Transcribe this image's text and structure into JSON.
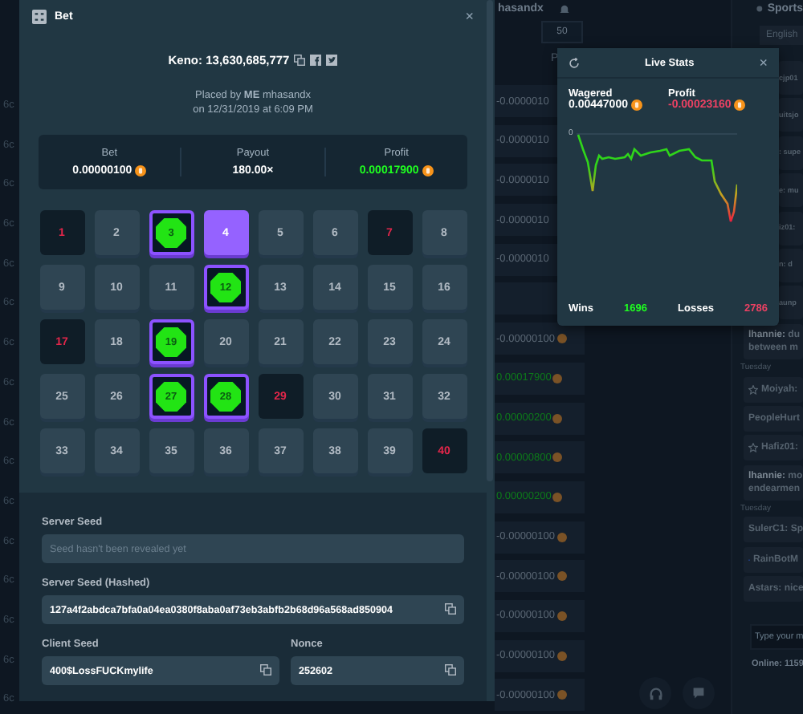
{
  "background": {
    "left_rows": [
      "6c",
      "6c",
      "6c",
      "6c",
      "6c",
      "6c",
      "6c",
      "6c",
      "6c",
      "6c",
      "6c",
      "6c",
      "6c",
      "6c",
      "6c",
      "6c"
    ],
    "user_menu": "hasandx",
    "page_size": "50",
    "column_header": "P",
    "profits": [
      {
        "value": "-0.0000010",
        "positive": false,
        "coin": false
      },
      {
        "value": "-0.0000010",
        "positive": false,
        "coin": false
      },
      {
        "value": "-0.0000010",
        "positive": false,
        "coin": false
      },
      {
        "value": "-0.0000010",
        "positive": false,
        "coin": false
      },
      {
        "value": "-0.0000010",
        "positive": false,
        "coin": false
      },
      {
        "value": "-0.00000100",
        "positive": false,
        "coin": true
      },
      {
        "value": "0.00017900",
        "positive": true,
        "coin": true
      },
      {
        "value": "0.00000200",
        "positive": true,
        "coin": true
      },
      {
        "value": "0.00000800",
        "positive": true,
        "coin": true
      },
      {
        "value": "0.00000200",
        "positive": true,
        "coin": true
      },
      {
        "value": "-0.00000100",
        "positive": false,
        "coin": true
      },
      {
        "value": "-0.00000100",
        "positive": false,
        "coin": true
      },
      {
        "value": "-0.00000100",
        "positive": false,
        "coin": true
      },
      {
        "value": "-0.00000100",
        "positive": false,
        "coin": true
      },
      {
        "value": "-0.00000100",
        "positive": false,
        "coin": true
      }
    ]
  },
  "chat": {
    "sports": "Sports",
    "language": "English",
    "messages": [
      {
        "kind": "cut",
        "lines": [
          "cjp01"
        ]
      },
      {
        "kind": "cut",
        "lines": [
          "uitsjo"
        ]
      },
      {
        "kind": "cut",
        "lines": [
          ": supe"
        ]
      },
      {
        "kind": "cut",
        "lines": [
          "e: mu"
        ]
      },
      {
        "kind": "cut",
        "lines": [
          "iz01:"
        ]
      },
      {
        "kind": "cut",
        "lines": [
          "n: d"
        ]
      },
      {
        "kind": "cut",
        "lines": [
          "aunp"
        ]
      },
      {
        "kind": "message",
        "lines": [
          "**lhannie:** du",
          "between m"
        ]
      },
      {
        "kind": "day",
        "lines": [
          "Tuesday"
        ]
      },
      {
        "kind": "starred",
        "lines": [
          "Moiyah:"
        ]
      },
      {
        "kind": "message",
        "lines": [
          "PeopleHurt"
        ]
      },
      {
        "kind": "starred",
        "lines": [
          "Hafiz01:"
        ]
      },
      {
        "kind": "message",
        "lines": [
          "**lhannie:** mo",
          "endearmen"
        ]
      },
      {
        "kind": "day",
        "lines": [
          "Tuesday"
        ]
      },
      {
        "kind": "message",
        "lines": [
          "SulerC1: Sp"
        ]
      },
      {
        "kind": "bot",
        "lines": [
          "RainBotM"
        ]
      },
      {
        "kind": "message",
        "lines": [
          "Astars: nice"
        ]
      }
    ],
    "input_placeholder": "Type your m",
    "online": "Online: 1159"
  },
  "modal": {
    "title": "Bet",
    "close": "×",
    "game_id": "Keno: 13,630,685,777",
    "placed_by": "Placed by **ME** mhasandx",
    "placed_on": "on 12/31/2019 at 6:09 PM",
    "stats": [
      {
        "label": "Bet",
        "value": "0.00000100",
        "coin": true,
        "positive": false
      },
      {
        "label": "Payout",
        "value": "180.00×",
        "coin": false,
        "positive": false
      },
      {
        "label": "Profit",
        "value": "0.00017900",
        "coin": true,
        "positive": true
      }
    ],
    "tiles": [
      {
        "number": "1",
        "selected": false,
        "drawn": true
      },
      {
        "number": "2",
        "selected": false,
        "drawn": false
      },
      {
        "number": "3",
        "selected": true,
        "drawn": true
      },
      {
        "number": "4",
        "selected": true,
        "drawn": false
      },
      {
        "number": "5",
        "selected": false,
        "drawn": false
      },
      {
        "number": "6",
        "selected": false,
        "drawn": false
      },
      {
        "number": "7",
        "selected": false,
        "drawn": true
      },
      {
        "number": "8",
        "selected": false,
        "drawn": false
      },
      {
        "number": "9",
        "selected": false,
        "drawn": false
      },
      {
        "number": "10",
        "selected": false,
        "drawn": false
      },
      {
        "number": "11",
        "selected": false,
        "drawn": false
      },
      {
        "number": "12",
        "selected": true,
        "drawn": true
      },
      {
        "number": "13",
        "selected": false,
        "drawn": false
      },
      {
        "number": "14",
        "selected": false,
        "drawn": false
      },
      {
        "number": "15",
        "selected": false,
        "drawn": false
      },
      {
        "number": "16",
        "selected": false,
        "drawn": false
      },
      {
        "number": "17",
        "selected": false,
        "drawn": true
      },
      {
        "number": "18",
        "selected": false,
        "drawn": false
      },
      {
        "number": "19",
        "selected": true,
        "drawn": true
      },
      {
        "number": "20",
        "selected": false,
        "drawn": false
      },
      {
        "number": "21",
        "selected": false,
        "drawn": false
      },
      {
        "number": "22",
        "selected": false,
        "drawn": false
      },
      {
        "number": "23",
        "selected": false,
        "drawn": false
      },
      {
        "number": "24",
        "selected": false,
        "drawn": false
      },
      {
        "number": "25",
        "selected": false,
        "drawn": false
      },
      {
        "number": "26",
        "selected": false,
        "drawn": false
      },
      {
        "number": "27",
        "selected": true,
        "drawn": true
      },
      {
        "number": "28",
        "selected": true,
        "drawn": true
      },
      {
        "number": "29",
        "selected": false,
        "drawn": true
      },
      {
        "number": "30",
        "selected": false,
        "drawn": false
      },
      {
        "number": "31",
        "selected": false,
        "drawn": false
      },
      {
        "number": "32",
        "selected": false,
        "drawn": false
      },
      {
        "number": "33",
        "selected": false,
        "drawn": false
      },
      {
        "number": "34",
        "selected": false,
        "drawn": false
      },
      {
        "number": "35",
        "selected": false,
        "drawn": false
      },
      {
        "number": "36",
        "selected": false,
        "drawn": false
      },
      {
        "number": "37",
        "selected": false,
        "drawn": false
      },
      {
        "number": "38",
        "selected": false,
        "drawn": false
      },
      {
        "number": "39",
        "selected": false,
        "drawn": false
      },
      {
        "number": "40",
        "selected": false,
        "drawn": true
      }
    ],
    "server_seed": {
      "label": "Server Seed",
      "placeholder": "Seed hasn't been revealed yet"
    },
    "hashed_seed": {
      "label": "Server Seed (Hashed)",
      "value": "127a4f2abdca7bfa0a04ea0380f8aba0af73eb3abfb2b68d96a568ad850904"
    },
    "client_seed": {
      "label": "Client Seed",
      "value": "400$LossFUCKmylife"
    },
    "nonce": {
      "label": "Nonce",
      "value": "252602"
    }
  },
  "live_stats": {
    "title": "Live Stats",
    "close": "×",
    "wagered_label": "Wagered",
    "wagered": "0.00447000",
    "profit_label": "Profit",
    "profit": "-0.00023160",
    "profit_positive": false,
    "chart_zero": "0",
    "wins_label": "Wins",
    "wins": "1696",
    "losses_label": "Losses",
    "losses": "2786"
  }
}
